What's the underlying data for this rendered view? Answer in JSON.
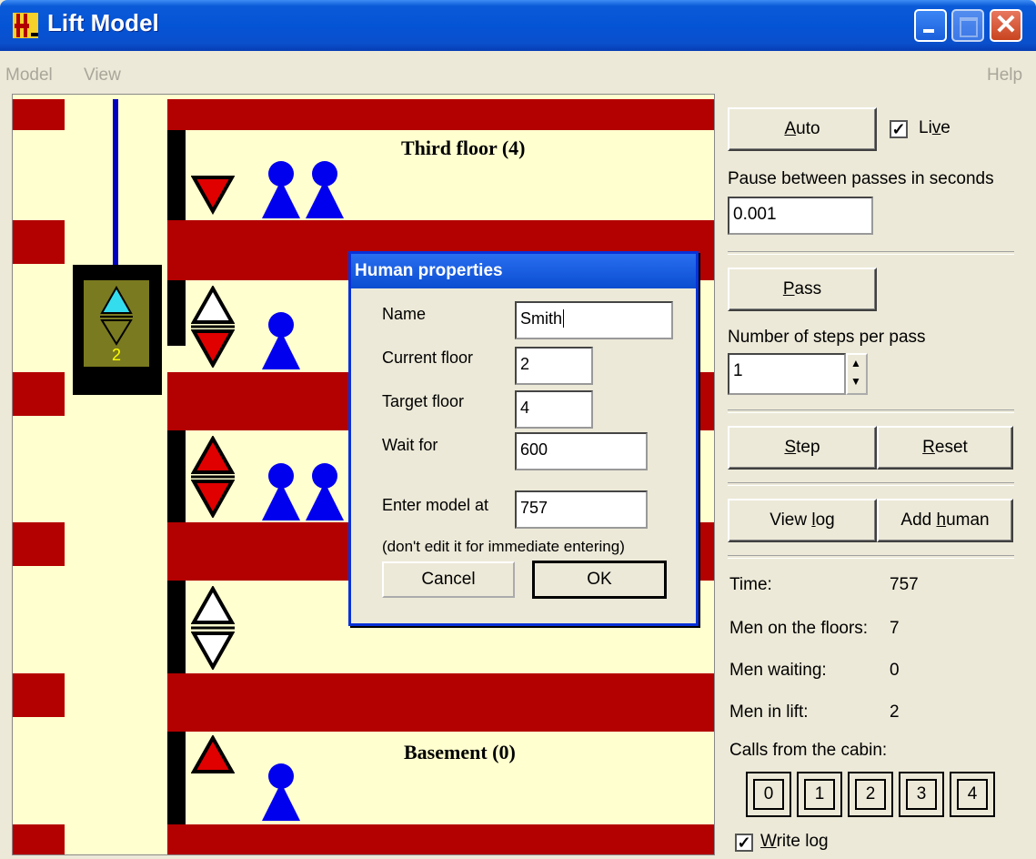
{
  "window": {
    "title": "Lift Model"
  },
  "menu": {
    "model": "Model",
    "view": "View",
    "help": "Help"
  },
  "floors": {
    "third": "Third floor (4)",
    "basement": "Basement (0)"
  },
  "cabin": {
    "floor_number": "2"
  },
  "dialog": {
    "title": "Human properties",
    "name_label": "Name",
    "name_value": "Smith",
    "current_floor_label": "Current floor",
    "current_floor_value": "2",
    "target_floor_label": "Target floor",
    "target_floor_value": "4",
    "wait_label": "Wait for",
    "wait_value": "600",
    "enter_label": "Enter model at",
    "enter_value": "757",
    "hint": "(don't edit it for immediate entering)",
    "cancel": "Cancel",
    "ok": "OK"
  },
  "panel": {
    "auto_pre": "",
    "auto_ul": "A",
    "auto_post": "uto",
    "live_pre": "Li",
    "live_ul": "v",
    "live_post": "e",
    "live_checked": true,
    "pause_label": "Pause between passes in seconds",
    "pause_value": "0.001",
    "pass_ul": "P",
    "pass_post": "ass",
    "steps_label": "Number of steps per pass",
    "steps_value": "1",
    "step_ul": "S",
    "step_post": "tep",
    "reset_ul": "R",
    "reset_post": "eset",
    "viewlog_pre": "View ",
    "viewlog_ul": "l",
    "viewlog_post": "og",
    "addhuman_pre": "Add ",
    "addhuman_ul": "h",
    "addhuman_post": "uman",
    "time_label": "Time:",
    "time_value": "757",
    "floors_label": "Men on the floors:",
    "floors_value": "7",
    "waiting_label": "Men waiting:",
    "waiting_value": "0",
    "inlift_label": "Men in lift:",
    "inlift_value": "2",
    "calls_label": "Calls from the cabin:",
    "calls": [
      "0",
      "1",
      "2",
      "3",
      "4"
    ],
    "writelog_ul": "W",
    "writelog_post": "rite log",
    "writelog_checked": true
  },
  "colors": {
    "wall": "#b30000",
    "background": "#ffffcf",
    "person": "#0000ee",
    "arrow_active": "#e00000",
    "cabin_up": "#33ddee",
    "cabin": "#7a7a20"
  }
}
